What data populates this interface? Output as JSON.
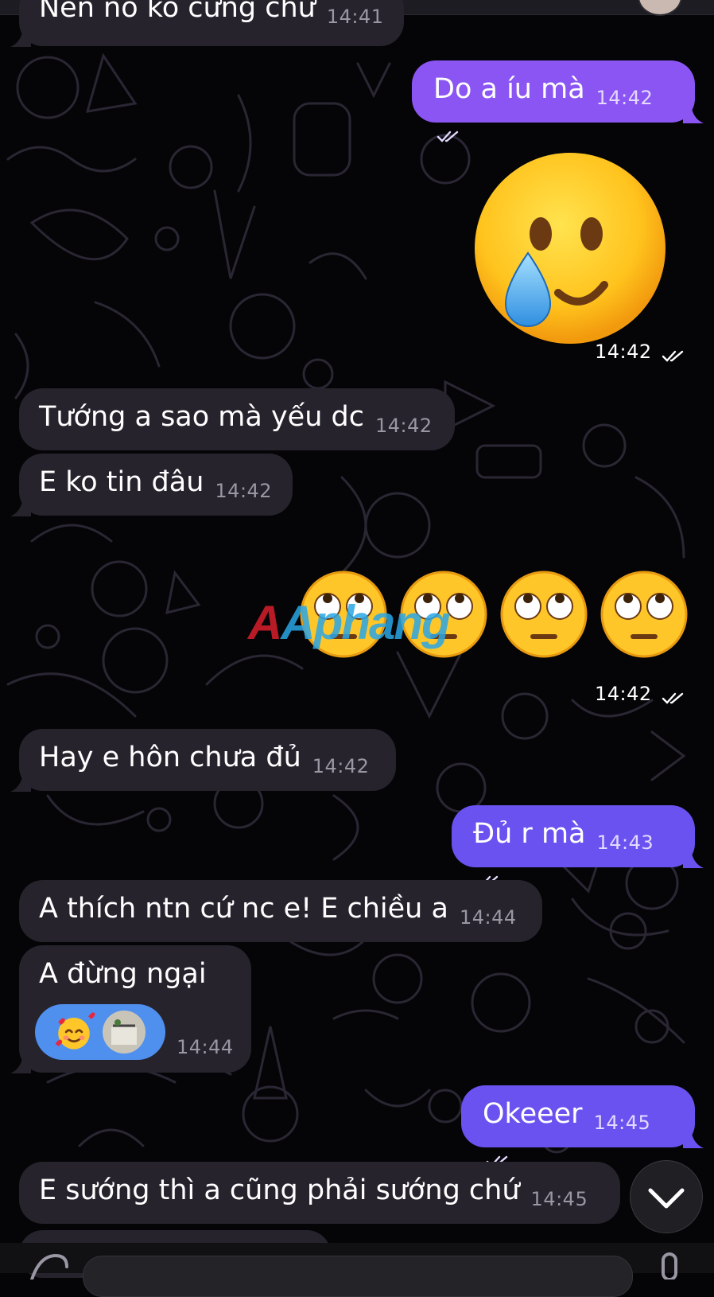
{
  "messages": [
    {
      "text": "Nên nó ko cứng chứ",
      "time": "14:41"
    },
    {
      "text": "Do a íu mà",
      "time": "14:42"
    },
    {
      "time": "14:42"
    },
    {
      "text": "Tướng a sao mà yếu dc",
      "time": "14:42"
    },
    {
      "text": "E ko tin đâu",
      "time": "14:42"
    },
    {
      "time": "14:42"
    },
    {
      "text": "Hay e hôn chưa đủ",
      "time": "14:42"
    },
    {
      "text": "Đủ r mà",
      "time": "14:43"
    },
    {
      "text": "A thích ntn cứ nc e! E chiều a",
      "time": "14:44"
    },
    {
      "text": "A đừng ngại",
      "time": "14:44"
    },
    {
      "text": "Okeeer",
      "time": "14:45"
    },
    {
      "text": "E sướng thì a cũng phải sướng chứ",
      "time": "14:45"
    }
  ],
  "stickers": {
    "big": "smiling-face-with-tear",
    "row": [
      "face-with-rolling-eyes",
      "face-with-rolling-eyes",
      "face-with-rolling-eyes",
      "face-with-rolling-eyes"
    ]
  },
  "reactions": [
    "smiling-face-with-hearts",
    "user-avatar"
  ],
  "watermark": "Aphang",
  "colors": {
    "background": "#050507",
    "incoming_bubble": "#26232d",
    "outgoing_bubble": "#8b55f3",
    "reaction_pill": "#4f90ef"
  }
}
